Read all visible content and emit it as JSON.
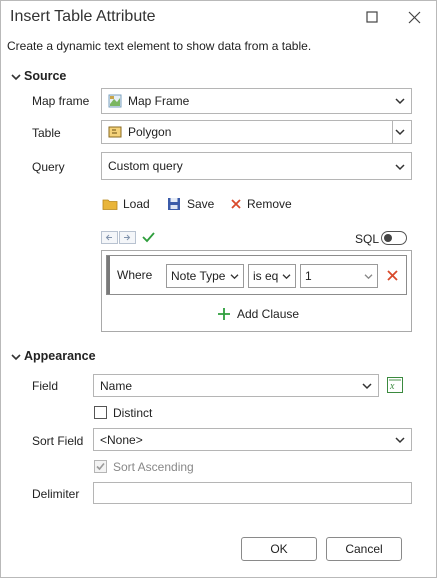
{
  "window": {
    "title": "Insert Table Attribute",
    "maximize_icon": "maximize-icon",
    "close_icon": "close-icon"
  },
  "subtitle": "Create a dynamic text element to show data from a table.",
  "source": {
    "header": "Source",
    "map_frame": {
      "label": "Map frame",
      "value": "Map Frame",
      "icon": "map-frame-icon"
    },
    "table": {
      "label": "Table",
      "value": "Polygon",
      "icon": "polygon-layer-icon"
    },
    "query": {
      "label": "Query",
      "value": "Custom query"
    },
    "toolbar": {
      "load": "Load",
      "save": "Save",
      "remove": "Remove"
    },
    "sql_label": "SQL",
    "sql_enabled": false,
    "clause": {
      "keyword": "Where",
      "field": "Note Type",
      "operator": "is eq",
      "value": "1"
    },
    "add_clause": "Add Clause"
  },
  "appearance": {
    "header": "Appearance",
    "field": {
      "label": "Field",
      "value": "Name"
    },
    "distinct": {
      "label": "Distinct",
      "checked": false
    },
    "sort_field": {
      "label": "Sort Field",
      "value": "<None>"
    },
    "sort_ascending": {
      "label": "Sort Ascending",
      "checked": true,
      "enabled": false
    },
    "delimiter": {
      "label": "Delimiter",
      "value": ""
    }
  },
  "buttons": {
    "ok": "OK",
    "cancel": "Cancel"
  },
  "colors": {
    "accent_green": "#2e9e3c",
    "remove_red": "#d94a2b",
    "folder_yellow": "#e9b53a",
    "save_blue": "#3b5ba9"
  }
}
